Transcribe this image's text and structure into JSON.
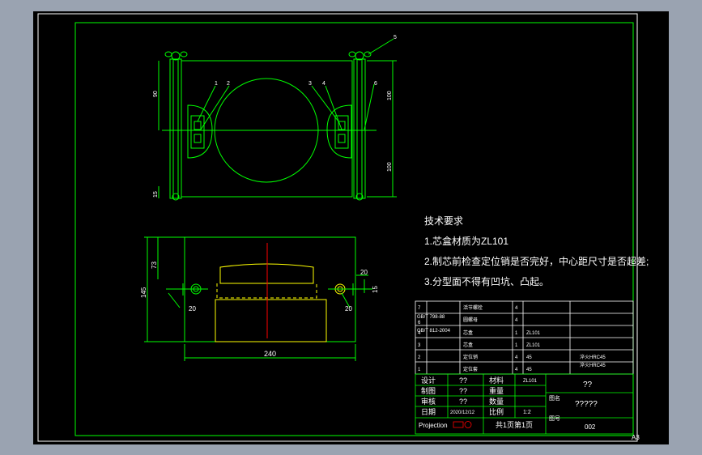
{
  "colors": {
    "background": "#9aa3b1",
    "sheet": "#000000",
    "border": "#ffffff",
    "frame": "#00ff00",
    "cyan": "#00e5e5",
    "yellow": "#ffff00",
    "red": "#ff0000",
    "text": "#ffffff"
  },
  "sheet": {
    "size_code": "A3"
  },
  "top_view": {
    "balloons": [
      "1",
      "2",
      "3",
      "4",
      "5",
      "6"
    ],
    "dims": {
      "upper_left": "90",
      "lower_left": "15",
      "upper_right": "100",
      "lower_right": "100"
    }
  },
  "front_view": {
    "dims": {
      "height_top": "73",
      "height_total": "145",
      "width": "240",
      "left_lug": "20",
      "right_lug_top": "20",
      "right_lug_bottom": "20",
      "right_gap": "15"
    }
  },
  "tech_requirements": {
    "title": "技术要求",
    "items": [
      "1.芯盒材质为ZL101",
      "2.制芯前检查定位销是否完好，中心距尺寸是否超差;",
      "3.分型面不得有凹坑、凸起。"
    ]
  },
  "parts_list": {
    "rows": [
      {
        "no": "7",
        "code": "GB/T 798-88",
        "name": "活节螺栓",
        "qty": "4",
        "material": "",
        "note": ""
      },
      {
        "no": "6",
        "code": "GB/T 812-2004",
        "name": "圆螺母",
        "qty": "4",
        "material": "",
        "note": ""
      },
      {
        "no": "4",
        "code": "",
        "name": "芯盒",
        "qty": "1",
        "material": "ZL101",
        "note": ""
      },
      {
        "no": "3",
        "code": "",
        "name": "芯盒",
        "qty": "1",
        "material": "ZL101",
        "note": ""
      },
      {
        "no": "2",
        "code": "",
        "name": "定位销",
        "qty": "4",
        "material": "45",
        "note": "淬火HRC45"
      },
      {
        "no": "1",
        "code": "",
        "name": "定位套",
        "qty": "4",
        "material": "45",
        "note": "淬火HRC45"
      }
    ]
  },
  "title_block": {
    "rows": [
      {
        "label": "设计",
        "value": "??",
        "label2": "材料",
        "value2": "ZL101"
      },
      {
        "label": "制图",
        "value": "??",
        "label2": "重量",
        "value2": ""
      },
      {
        "label": "审核",
        "value": "??",
        "label2": "数量",
        "value2": ""
      },
      {
        "label": "日期",
        "value": "2020/12/12",
        "label2": "比例",
        "value2": "1:2"
      }
    ],
    "projection_label": "Projection",
    "sheet_info": "共1页第1页",
    "school": "??",
    "drawing_name_label": "图名",
    "drawing_name": "?????",
    "drawing_no_label": "图号",
    "drawing_no": "002"
  }
}
